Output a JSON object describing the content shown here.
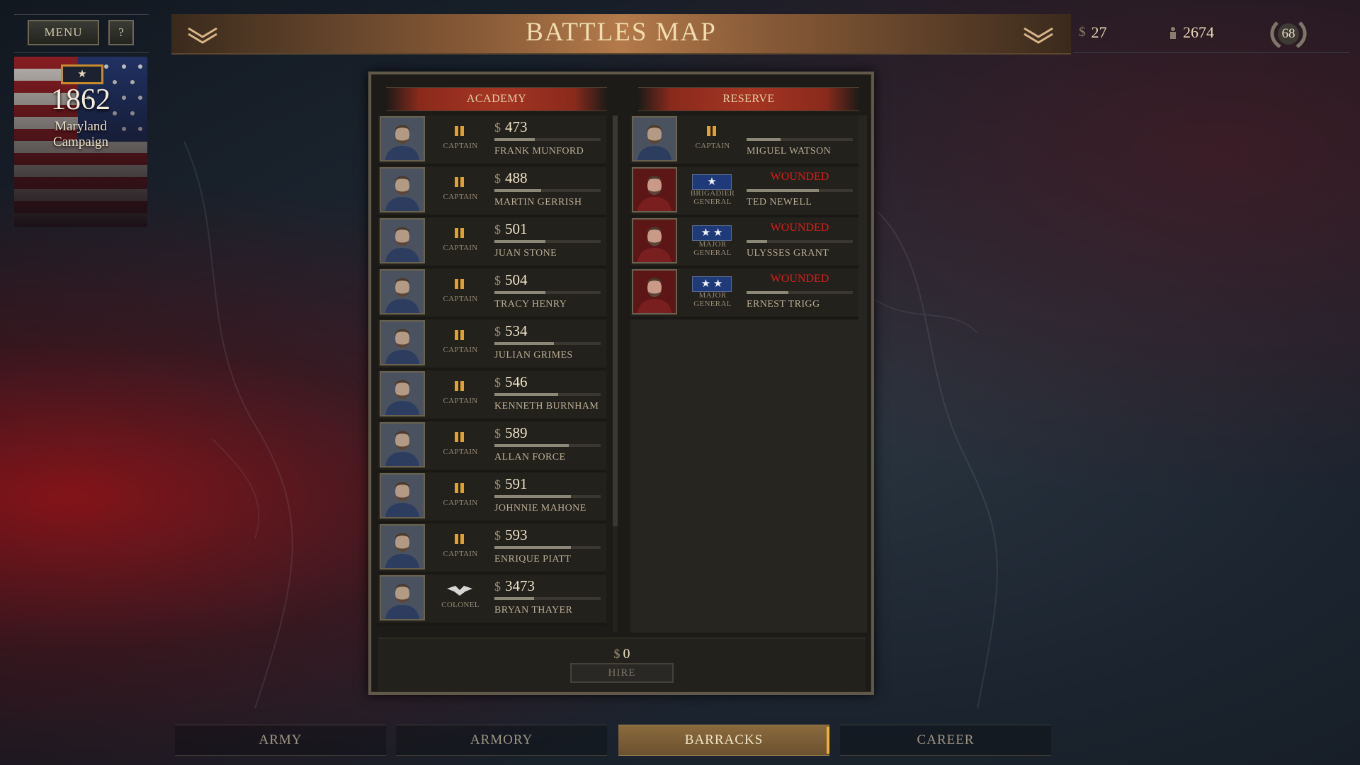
{
  "top": {
    "menu_label": "MENU",
    "help_label": "?",
    "title": "BATTLES MAP",
    "money_symbol": "$",
    "money": "27",
    "recruits": "2674",
    "rank_level": "68"
  },
  "campaign": {
    "badge": "★",
    "year": "1862",
    "name_line1": "Maryland",
    "name_line2": "Campaign"
  },
  "academy": {
    "header": "ACADEMY",
    "officers": [
      {
        "price": "473",
        "rank": "CAPTAIN",
        "name": "FRANK MUNFORD",
        "xp": 0.38
      },
      {
        "price": "488",
        "rank": "CAPTAIN",
        "name": "MARTIN GERRISH",
        "xp": 0.44
      },
      {
        "price": "501",
        "rank": "CAPTAIN",
        "name": "JUAN STONE",
        "xp": 0.48
      },
      {
        "price": "504",
        "rank": "CAPTAIN",
        "name": "TRACY HENRY",
        "xp": 0.48
      },
      {
        "price": "534",
        "rank": "CAPTAIN",
        "name": "JULIAN GRIMES",
        "xp": 0.56
      },
      {
        "price": "546",
        "rank": "CAPTAIN",
        "name": "KENNETH BURNHAM",
        "xp": 0.6
      },
      {
        "price": "589",
        "rank": "CAPTAIN",
        "name": "ALLAN FORCE",
        "xp": 0.7
      },
      {
        "price": "591",
        "rank": "CAPTAIN",
        "name": "JOHNNIE MAHONE",
        "xp": 0.72
      },
      {
        "price": "593",
        "rank": "CAPTAIN",
        "name": "ENRIQUE PIATT",
        "xp": 0.72
      },
      {
        "price": "3473",
        "rank": "COLONEL",
        "name": "BRYAN THAYER",
        "xp": 0.37
      }
    ]
  },
  "reserve": {
    "header": "RESERVE",
    "officers": [
      {
        "status": "",
        "rank_line1": "CAPTAIN",
        "rank_line2": "",
        "stars": "",
        "name": "MIGUEL WATSON",
        "xp": 0.32
      },
      {
        "status": "WOUNDED",
        "rank_line1": "BRIGADIER",
        "rank_line2": "GENERAL",
        "stars": "★",
        "name": "TED NEWELL",
        "xp": 0.68
      },
      {
        "status": "WOUNDED",
        "rank_line1": "MAJOR",
        "rank_line2": "GENERAL",
        "stars": "★ ★",
        "name": "ULYSSES GRANT",
        "xp": 0.19
      },
      {
        "status": "WOUNDED",
        "rank_line1": "MAJOR",
        "rank_line2": "GENERAL",
        "stars": "★ ★",
        "name": "ERNEST TRIGG",
        "xp": 0.39
      }
    ]
  },
  "footer": {
    "cost_symbol": "$",
    "cost": "0",
    "hire_label": "HIRE"
  },
  "tabs": [
    {
      "label": "ARMY",
      "active": false
    },
    {
      "label": "ARMORY",
      "active": false
    },
    {
      "label": "BARRACKS",
      "active": true
    },
    {
      "label": "CAREER",
      "active": false
    }
  ],
  "colors": {
    "accent": "#e2a12a",
    "wounded": "#d81f1a",
    "panel": "#1d1b17",
    "title_bar": "#b37a4a"
  }
}
